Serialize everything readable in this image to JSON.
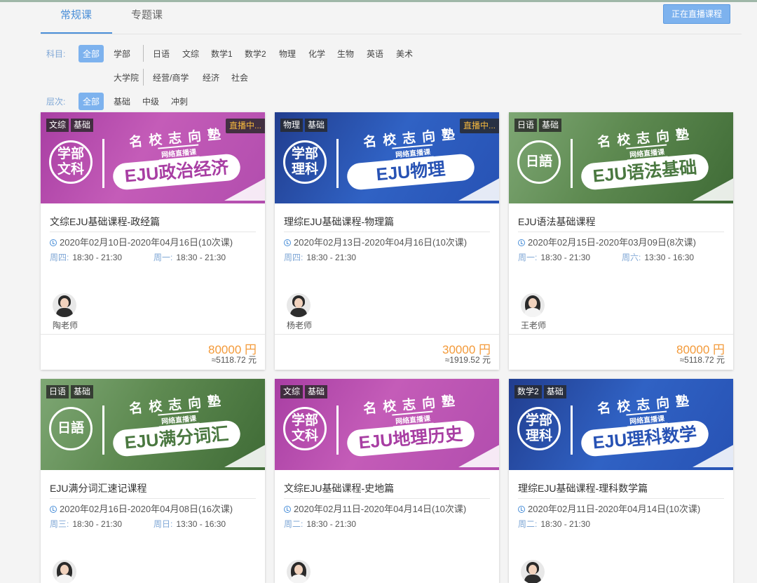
{
  "tabs": [
    {
      "label": "常规课"
    },
    {
      "label": "专题课"
    }
  ],
  "live_button": "正在直播课程",
  "filters": {
    "subject_label": "科目:",
    "subject_all": "全部",
    "subject_row1": [
      "学部",
      "日语",
      "文综",
      "数学1",
      "数学2",
      "物理",
      "化学",
      "生物",
      "英语",
      "美术"
    ],
    "subject_row2": [
      "大学院",
      "经营/商学",
      "经济",
      "社会"
    ],
    "level_label": "层次:",
    "level_all": "全部",
    "levels": [
      "基础",
      "中级",
      "冲刺"
    ]
  },
  "courses": [
    {
      "badges": [
        "文综",
        "基础"
      ],
      "live": "直播中...",
      "logo": "学部\n文科",
      "school": "名校志向塾",
      "net": "网络直播课",
      "banner_title": "EJU政治经济",
      "title": "文综EJU基础课程-政经篇",
      "date": "2020年02月10日-2020年04月16日(10次课)",
      "schedule": [
        {
          "day": "周四:",
          "time": "18:30 - 21:30"
        },
        {
          "day": "周一:",
          "time": "18:30 - 21:30"
        }
      ],
      "teacher": "陶老师",
      "price": "80000 円",
      "approx": "≈5118.72 元",
      "theme": "pink"
    },
    {
      "badges": [
        "物理",
        "基础"
      ],
      "live": "直播中...",
      "logo": "学部\n理科",
      "school": "名校志向塾",
      "net": "网络直播课",
      "banner_title": "EJU物理",
      "title": "理综EJU基础课程-物理篇",
      "date": "2020年02月13日-2020年04月16日(10次课)",
      "schedule": [
        {
          "day": "周四:",
          "time": "18:30 - 21:30"
        }
      ],
      "teacher": "杨老师",
      "price": "30000 円",
      "approx": "≈1919.52 元",
      "theme": "blue"
    },
    {
      "badges": [
        "日语",
        "基础"
      ],
      "live": "",
      "logo": "日語",
      "school": "名校志向塾",
      "net": "网络直播课",
      "banner_title": "EJU语法基础",
      "title": "EJU语法基础课程",
      "date": "2020年02月15日-2020年03月09日(8次课)",
      "schedule": [
        {
          "day": "周一:",
          "time": "18:30 - 21:30"
        },
        {
          "day": "周六:",
          "time": "13:30 - 16:30"
        }
      ],
      "teacher": "王老师",
      "price": "80000 円",
      "approx": "≈5118.72 元",
      "theme": "green"
    },
    {
      "badges": [
        "日语",
        "基础"
      ],
      "live": "",
      "logo": "日語",
      "school": "名校志向塾",
      "net": "网络直播课",
      "banner_title": "EJU满分词汇",
      "title": "EJU满分词汇速记课程",
      "date": "2020年02月16日-2020年04月08日(16次课)",
      "schedule": [
        {
          "day": "周三:",
          "time": "18:30 - 21:30"
        },
        {
          "day": "周日:",
          "time": "13:30 - 16:30"
        }
      ],
      "teacher": "",
      "price": "",
      "approx": "",
      "theme": "green"
    },
    {
      "badges": [
        "文综",
        "基础"
      ],
      "live": "",
      "logo": "学部\n文科",
      "school": "名校志向塾",
      "net": "网络直播课",
      "banner_title": "EJU地理历史",
      "title": "文综EJU基础课程-史地篇",
      "date": "2020年02月11日-2020年04月14日(10次课)",
      "schedule": [
        {
          "day": "周二:",
          "time": "18:30 - 21:30"
        }
      ],
      "teacher": "",
      "price": "",
      "approx": "",
      "theme": "pink"
    },
    {
      "badges": [
        "数学2",
        "基础"
      ],
      "live": "",
      "logo": "学部\n理科",
      "school": "名校志向塾",
      "net": "网络直播课",
      "banner_title": "EJU理科数学",
      "title": "理综EJU基础课程-理科数学篇",
      "date": "2020年02月11日-2020年04月14日(10次课)",
      "schedule": [
        {
          "day": "周二:",
          "time": "18:30 - 21:30"
        }
      ],
      "teacher": "",
      "price": "",
      "approx": "",
      "theme": "blue"
    }
  ]
}
